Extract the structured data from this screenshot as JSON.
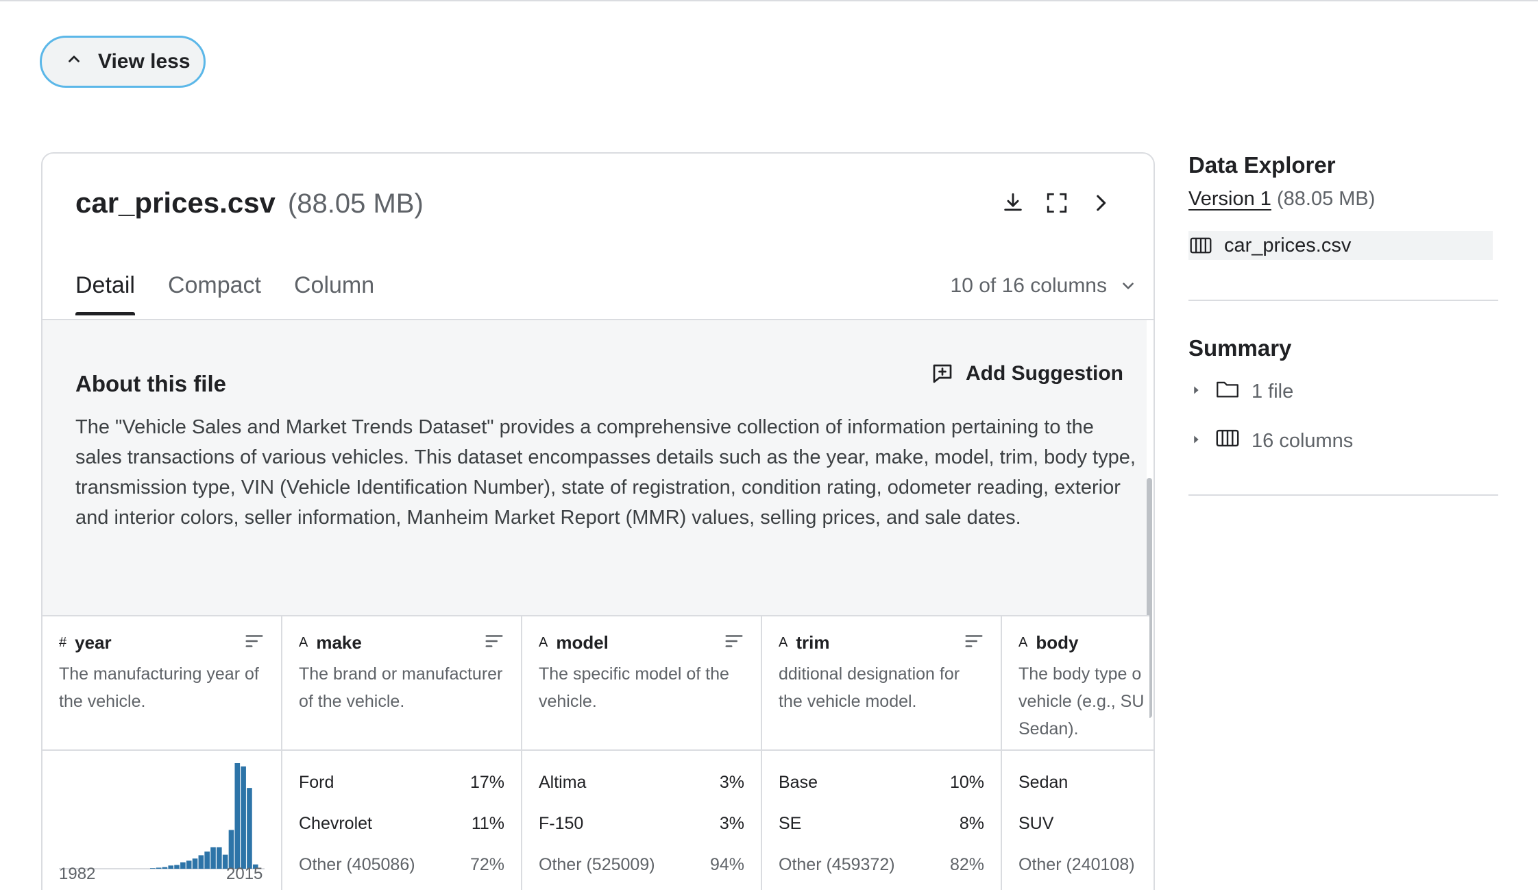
{
  "top_button": {
    "label": "View less"
  },
  "file": {
    "name": "car_prices.csv",
    "size": "(88.05 MB)"
  },
  "tabs": [
    {
      "label": "Detail",
      "active": true
    },
    {
      "label": "Compact",
      "active": false
    },
    {
      "label": "Column",
      "active": false
    }
  ],
  "columns_selector": "10 of 16 columns",
  "about": {
    "heading": "About this file",
    "add_suggestion": "Add Suggestion",
    "text": "The \"Vehicle Sales and Market Trends Dataset\" provides a comprehensive collection of information pertaining to the sales transactions of various vehicles. This dataset encompasses details such as the year, make, model, trim, body type, transmission type, VIN (Vehicle Identification Number), state of registration, condition rating, odometer reading, exterior and interior colors, seller information, Manheim Market Report (MMR) values, selling prices, and sale dates."
  },
  "columns": [
    {
      "type_glyph": "#",
      "name": "year",
      "desc": "The manufacturing year of the vehicle.",
      "histogram": {
        "min_label": "1982",
        "max_label": "2015"
      }
    },
    {
      "type_glyph": "A",
      "name": "make",
      "desc": "The brand or manufacturer of the vehicle.",
      "stats": [
        {
          "label": "Ford",
          "pct": "17%"
        },
        {
          "label": "Chevrolet",
          "pct": "11%"
        },
        {
          "label": "Other (405086)",
          "pct": "72%"
        }
      ]
    },
    {
      "type_glyph": "A",
      "name": "model",
      "desc": "The specific model of the vehicle.",
      "stats": [
        {
          "label": "Altima",
          "pct": "3%"
        },
        {
          "label": "F-150",
          "pct": "3%"
        },
        {
          "label": "Other (525009)",
          "pct": "94%"
        }
      ]
    },
    {
      "type_glyph": "A",
      "name": "trim",
      "desc": "dditional designation for the vehicle model.",
      "stats": [
        {
          "label": "Base",
          "pct": "10%"
        },
        {
          "label": "SE",
          "pct": "8%"
        },
        {
          "label": "Other (459372)",
          "pct": "82%"
        }
      ]
    },
    {
      "type_glyph": "A",
      "name": "body",
      "desc": "The body type o vehicle (e.g., SU Sedan).",
      "stats": [
        {
          "label": "Sedan",
          "pct": ""
        },
        {
          "label": "SUV",
          "pct": ""
        },
        {
          "label": "Other (240108)",
          "pct": ""
        }
      ]
    }
  ],
  "chart_data": {
    "type": "bar",
    "categories": [
      "1982",
      "1983",
      "1984",
      "1985",
      "1986",
      "1987",
      "1988",
      "1989",
      "1990",
      "1991",
      "1992",
      "1993",
      "1994",
      "1995",
      "1996",
      "1997",
      "1998",
      "1999",
      "2000",
      "2001",
      "2002",
      "2003",
      "2004",
      "2005",
      "2006",
      "2007",
      "2008",
      "2009",
      "2010",
      "2011",
      "2012",
      "2013",
      "2014",
      "2015"
    ],
    "values": [
      0,
      0,
      0,
      0,
      0,
      0,
      0,
      0,
      0,
      0,
      0,
      0,
      0,
      0,
      0,
      0.005,
      0.01,
      0.015,
      0.03,
      0.035,
      0.06,
      0.075,
      0.095,
      0.125,
      0.16,
      0.2,
      0.2,
      0.13,
      0.36,
      0.98,
      0.95,
      0.75,
      0.04,
      0
    ],
    "xlabel": "",
    "ylabel": "",
    "accent": "#2d74a8"
  },
  "sidebar": {
    "title": "Data Explorer",
    "version_link": "Version 1",
    "version_size": "(88.05 MB)",
    "file_item": "car_prices.csv",
    "summary_title": "Summary",
    "summary_items": [
      {
        "label": "1 file",
        "icon": "folder-icon"
      },
      {
        "label": "16 columns",
        "icon": "columns-icon"
      }
    ]
  }
}
